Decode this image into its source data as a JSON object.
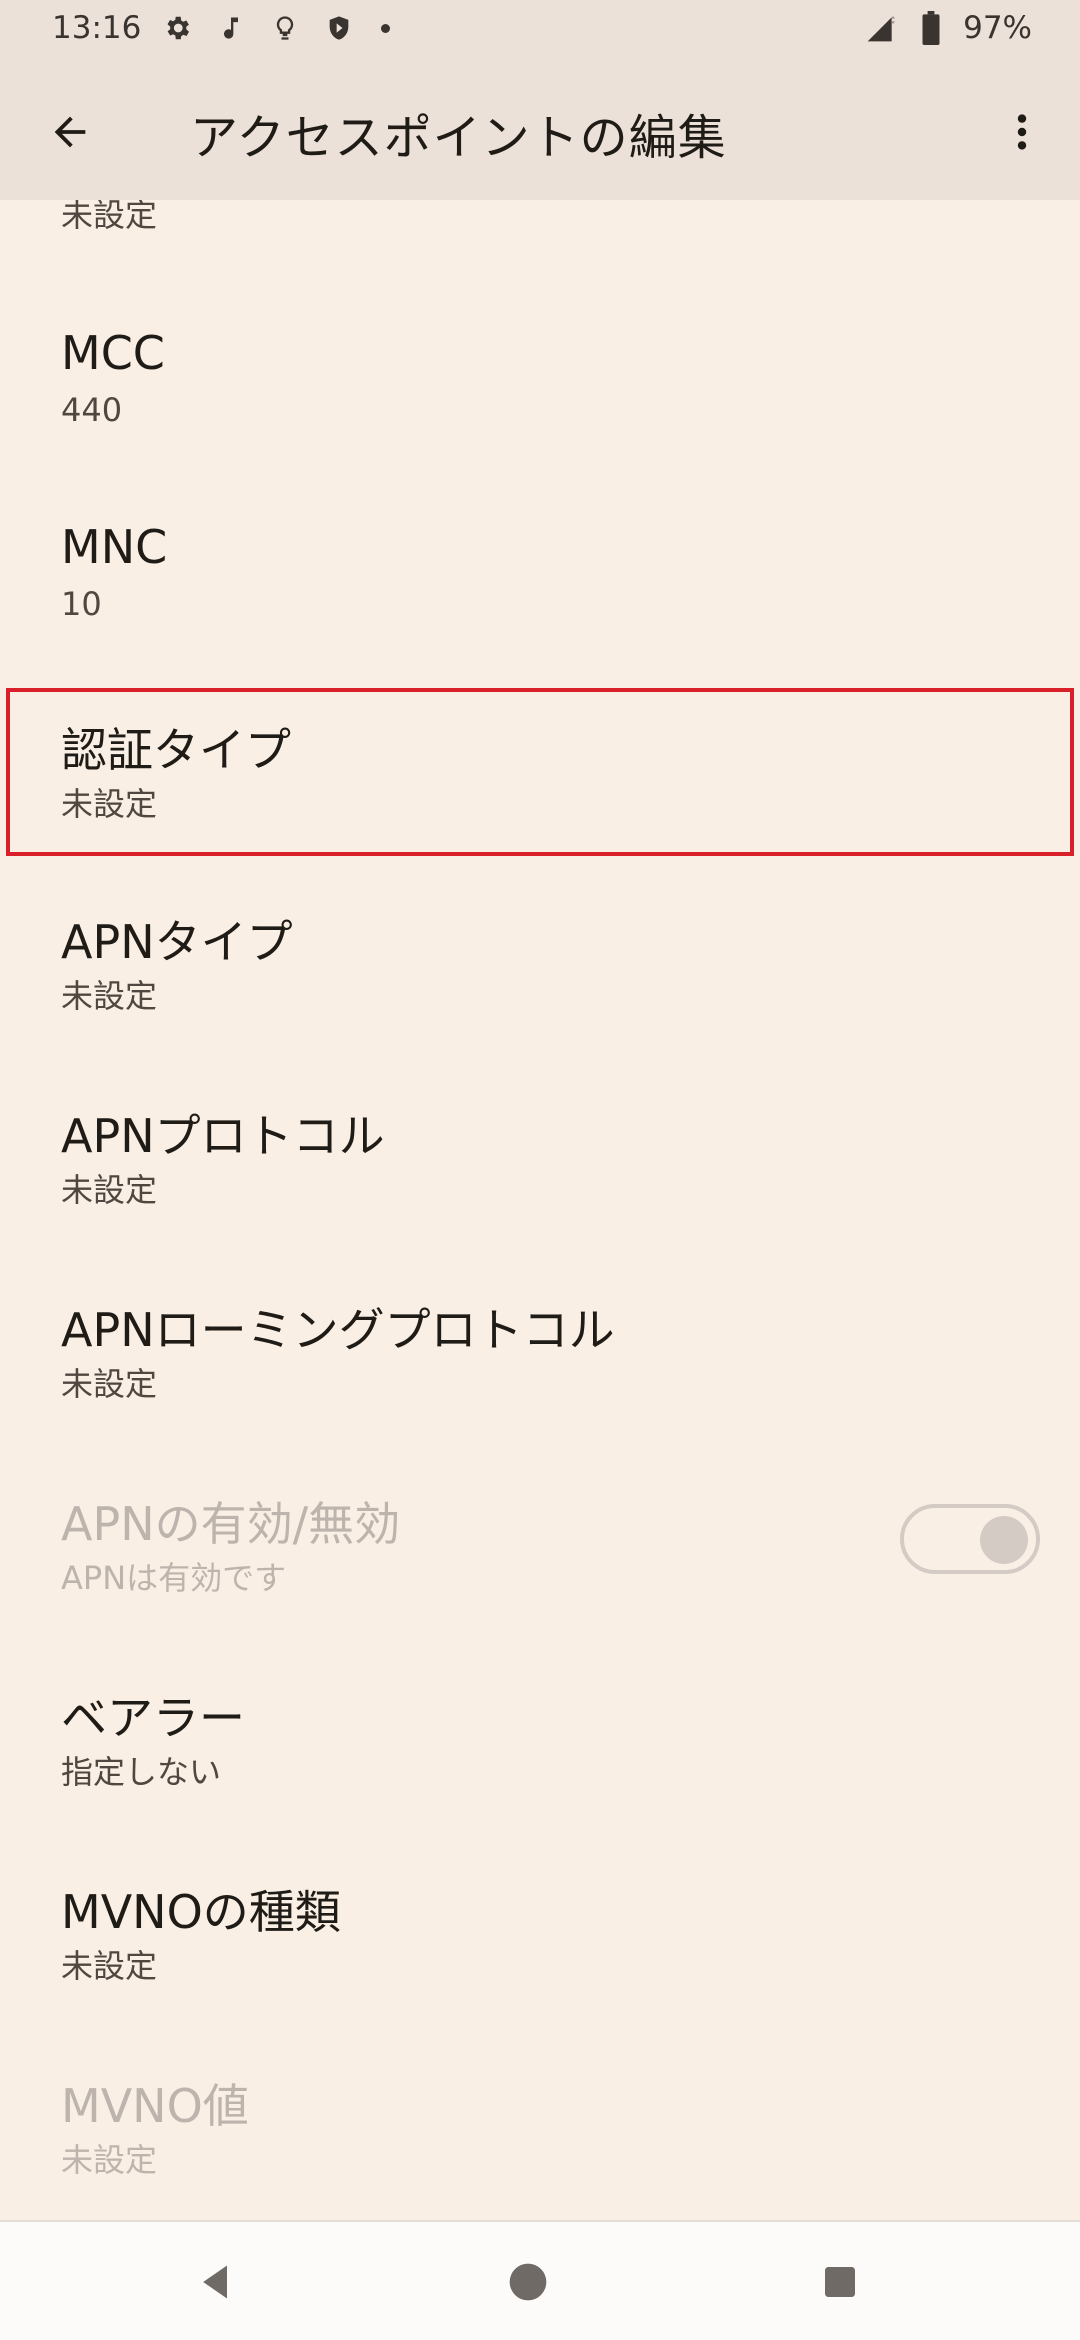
{
  "status_bar": {
    "time": "13:16",
    "battery": "97%",
    "icons": [
      "gear-icon",
      "music-note-icon",
      "lightbulb-icon",
      "shield-icon",
      "signal-icon",
      "battery-icon"
    ]
  },
  "app_bar": {
    "title": "アクセスポイントの編集",
    "back_icon": "arrow-back-icon",
    "more_icon": "more-vertical-icon"
  },
  "rows": [
    {
      "title": "",
      "summary": "未設定"
    },
    {
      "title": "MCC",
      "summary": "440"
    },
    {
      "title": "MNC",
      "summary": "10"
    },
    {
      "title": "認証タイプ",
      "summary": "未設定"
    },
    {
      "title": "APNタイプ",
      "summary": "未設定"
    },
    {
      "title": "APNプロトコル",
      "summary": "未設定"
    },
    {
      "title": "APNローミングプロトコル",
      "summary": "未設定"
    },
    {
      "title": "APNの有効/無効",
      "summary": "APNは有効です",
      "toggle_on": true,
      "disabled": true
    },
    {
      "title": "ベアラー",
      "summary": "指定しない"
    },
    {
      "title": "MVNOの種類",
      "summary": "未設定"
    },
    {
      "title": "MVNO値",
      "summary": "未設定",
      "disabled": true
    }
  ],
  "nav_bar": {
    "buttons": [
      "back-triangle-icon",
      "home-circle-icon",
      "recents-square-icon"
    ]
  },
  "colors": {
    "background": "#f9efe4",
    "app_bar": "#ece1d8",
    "highlight_border": "#d81f2a",
    "disabled_text": "#bdb4ad"
  }
}
